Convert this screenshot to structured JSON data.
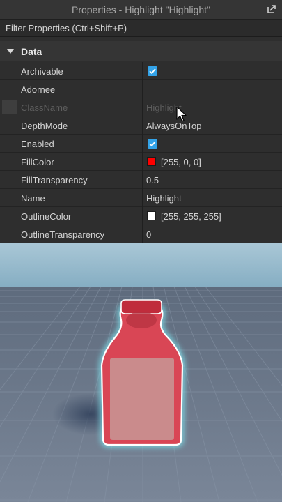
{
  "window": {
    "title": "Properties - Highlight \"Highlight\""
  },
  "filter": {
    "placeholder": "Filter Properties (Ctrl+Shift+P)"
  },
  "section": {
    "label": "Data",
    "expanded": true
  },
  "properties": [
    {
      "name": "Archivable",
      "type": "bool",
      "checked": true
    },
    {
      "name": "Adornee",
      "type": "text",
      "value": ""
    },
    {
      "name": "ClassName",
      "type": "text",
      "value": "Highlight",
      "readonly": true
    },
    {
      "name": "DepthMode",
      "type": "text",
      "value": "AlwaysOnTop"
    },
    {
      "name": "Enabled",
      "type": "bool",
      "checked": true
    },
    {
      "name": "FillColor",
      "type": "color",
      "value": "[255, 0, 0]",
      "color": "#ff0000"
    },
    {
      "name": "FillTransparency",
      "type": "text",
      "value": "0.5"
    },
    {
      "name": "Name",
      "type": "text",
      "value": "Highlight"
    },
    {
      "name": "OutlineColor",
      "type": "color",
      "value": "[255, 255, 255]",
      "color": "#ffffff"
    },
    {
      "name": "OutlineTransparency",
      "type": "text",
      "value": "0"
    }
  ],
  "colors": {
    "checkbox": "#33a3e8",
    "panel_bg": "#2e2e2e",
    "sky": "#8fb5cb",
    "ground": "#6a778a",
    "bottle_fill": "#e0505c",
    "bottle_outline": "#ffffff"
  },
  "icons": {
    "undock": "undock-icon",
    "section_toggle": "chevron-down-icon",
    "checkbox": "checkmark-icon",
    "cursor": "mouse-cursor-icon"
  }
}
